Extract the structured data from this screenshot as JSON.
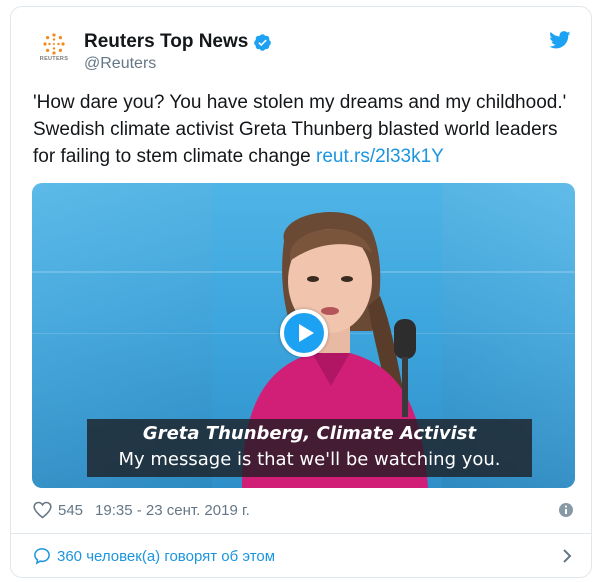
{
  "account": {
    "display_name": "Reuters Top News",
    "handle": "@Reuters",
    "avatar_text": "REUTERS",
    "verified": true
  },
  "tweet": {
    "text_line1": "'How dare you? You have stolen my dreams and my childhood.'",
    "text_line2": "Swedish climate activist Greta Thunberg blasted world leaders",
    "text_line3": "for failing to stem climate change ",
    "link": "reut.rs/2l33k1Y"
  },
  "video": {
    "caption_title": "Greta Thunberg, Climate Activist",
    "caption_subtitle": "My message is that we'll be watching you."
  },
  "footer": {
    "likes": "545",
    "timestamp": "19:35 - 23 сент. 2019 г.",
    "talking": "360 человек(а) говорят об этом"
  },
  "colors": {
    "link": "#1b95e0",
    "twitter_blue": "#1da1f2",
    "secondary_text": "#657786"
  }
}
